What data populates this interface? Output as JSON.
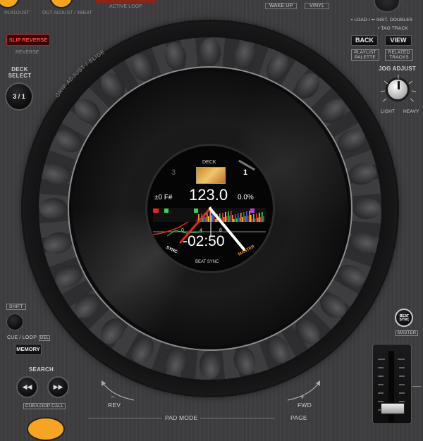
{
  "top": {
    "in_adjust": "IN ADJUST",
    "out_adjust": "OUT ADJUST / 4BEAT",
    "active_loop": "ACTIVE LOOP",
    "wake_up": "WAKE UP",
    "vinyl": "VINYL"
  },
  "left": {
    "slip_reverse_button": "SLIP REVERSE",
    "reverse_label": "REVERSE",
    "deck_select_label": "DECK SELECT",
    "deck_select_button": "3 / 1",
    "shift_label": "SHIFT",
    "cue_loop_label": "CUE / LOOP",
    "del_label": "DEL",
    "memory_button": "MEMORY",
    "search_label": "SEARCH",
    "cue_loop_call_label": "CUE/LOOP CALL"
  },
  "right": {
    "load_label": "• LOAD / •• INST. DOUBLES",
    "tag_track_label": "• TAG TRACK",
    "back_button": "BACK",
    "view_button": "VIEW",
    "playlist_palette_label": "PLAYLIST PALETTE",
    "related_tracks_label": "RELATED TRACKS",
    "jog_adjust_label": "JOG ADJUST",
    "light_label": "LIGHT",
    "heavy_label": "HEAVY",
    "beat_sync_button": "BEAT SYNC",
    "master_label": "MASTER"
  },
  "jog": {
    "grip_label": "GRIP ADJUST / SLIDE",
    "rev_label": "REV",
    "fwd_label": "FWD",
    "minus_sign": "−",
    "plus_sign": "+",
    "pad_mode_label": "PAD MODE",
    "page_label": "PAGE"
  },
  "display": {
    "deck_label": "DECK",
    "deck_left": "3",
    "deck_right": "1",
    "bpm": "123.0",
    "key": "±0 F#",
    "pitch": "0.0%",
    "time": "-02:50",
    "sync_label": "SYNC",
    "beat_sync_label": "BEAT SYNC",
    "master_label": "MASTER",
    "ruler_0": "0",
    "ruler_4": "4",
    "ruler_8": "8"
  },
  "colors": {
    "slip_red": "#c0141a",
    "display_orange": "#f29a1f",
    "wave_red": "#e02a1d",
    "wave_green": "#3bd25c"
  }
}
